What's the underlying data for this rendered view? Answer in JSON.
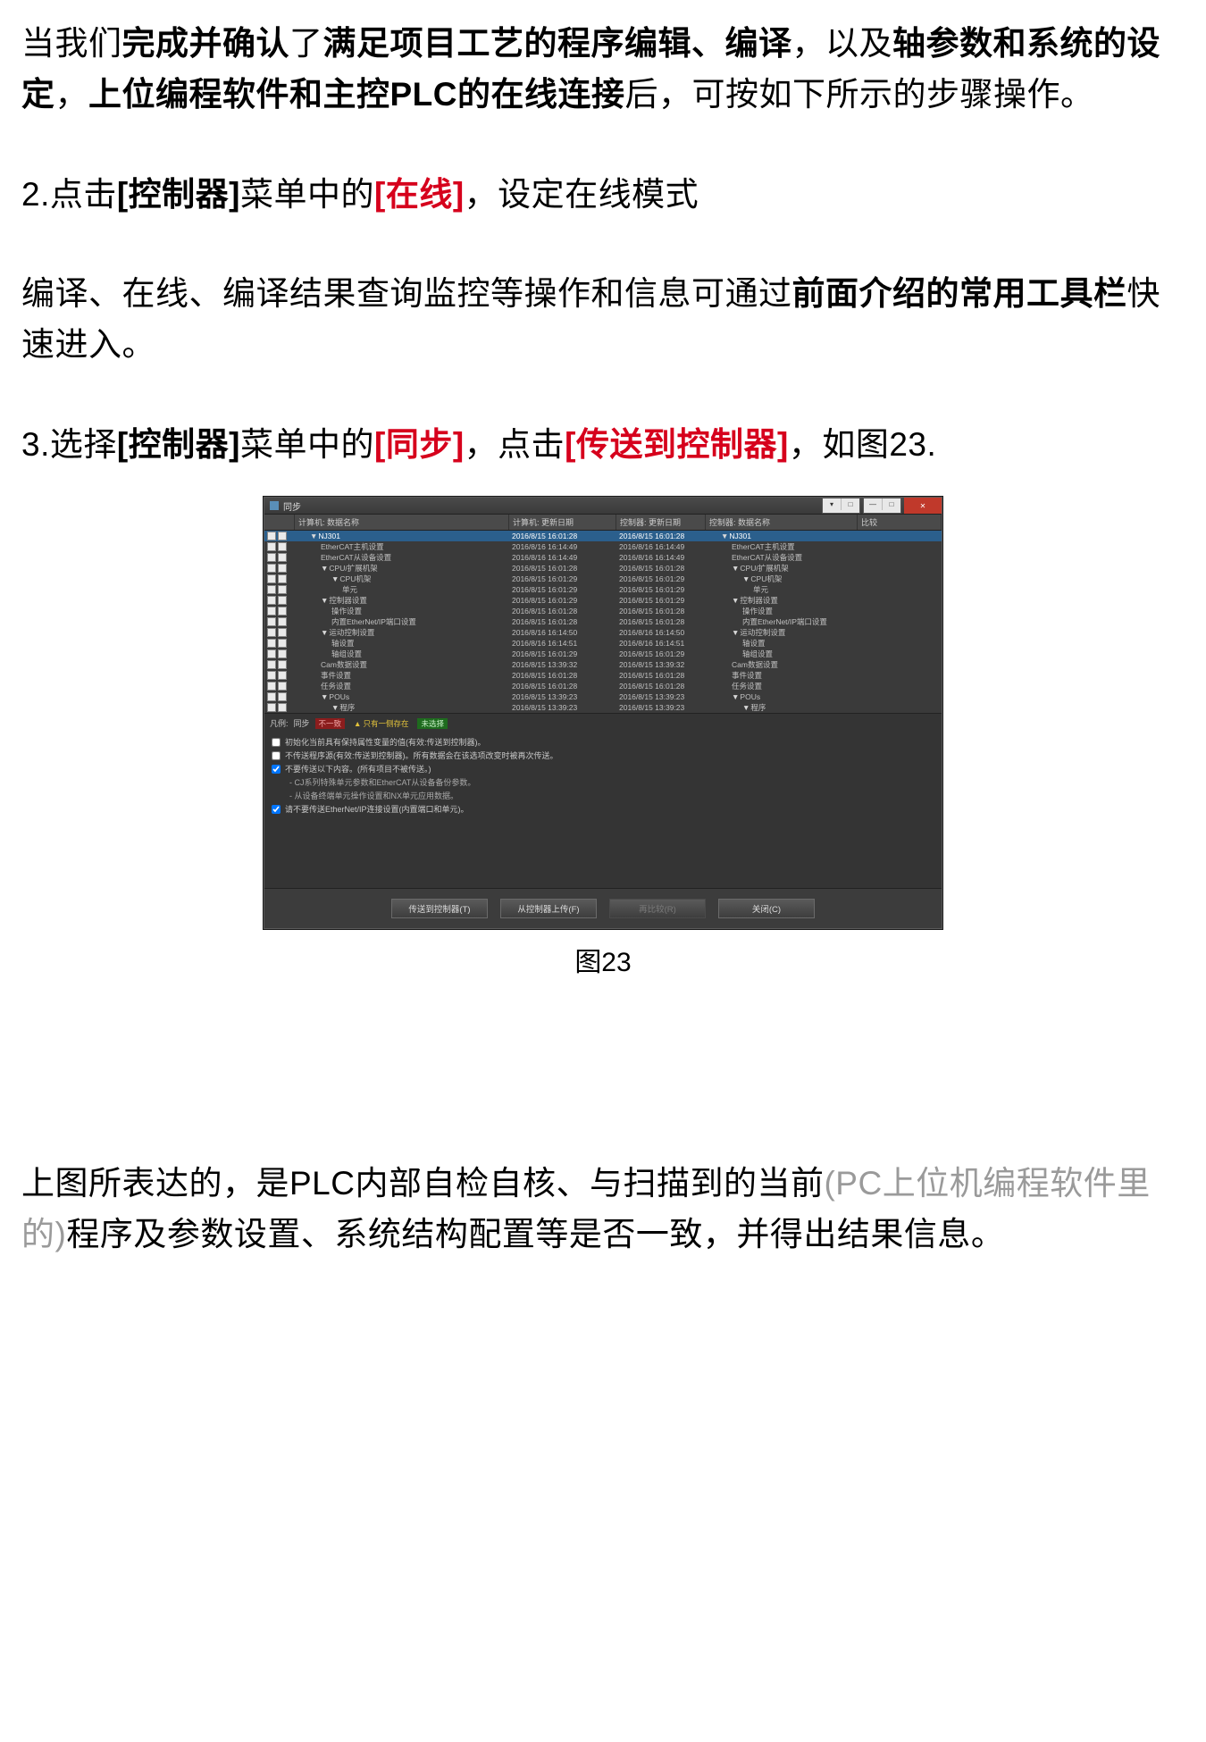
{
  "p1": {
    "a": "当我们",
    "b": "完成并确认",
    "c": "了",
    "d": "满足项目工艺的程序编辑、编译",
    "e": "，以及",
    "f": "轴参数和系统的设定",
    "g": "，",
    "h": "上位编程软件和主控PLC的在线连接",
    "i": "后，可按如下所示的步骤操作。"
  },
  "s2": {
    "a": "2.点击",
    "b": "[控制器]",
    "c": "菜单中的",
    "d": "[在线]",
    "e": "，设定在线模式"
  },
  "p3": {
    "a": "编译、在线、编译结果查询监控等操作和信息可通过",
    "b": "前面介绍的常用工具栏",
    "c": "快速进入。"
  },
  "s3": {
    "a": "3.选择",
    "b": "[控制器]",
    "c": "菜单中的",
    "d": "[同步]",
    "e": "，点击",
    "f": "[传送到控制器]",
    "g": "，如图23."
  },
  "dlg": {
    "title": "同步",
    "headers": {
      "h1": "计算机: 数据名称",
      "h2": "计算机: 更新日期",
      "h3": "控制器: 更新日期",
      "h4": "控制器: 数据名称",
      "h5": "比较"
    },
    "rows": [
      {
        "sel": true,
        "ind": 1,
        "tri": "▼",
        "n": "NJ301",
        "d1": "2016/8/15 16:01:28",
        "d2": "2016/8/15 16:01:28",
        "n2": "NJ301",
        "tri2": "▼",
        "ind2": 1
      },
      {
        "ind": 2,
        "n": "EtherCAT主机设置",
        "d1": "2016/8/16 16:14:49",
        "d2": "2016/8/16 16:14:49",
        "n2": "EtherCAT主机设置",
        "ind2": 2
      },
      {
        "ind": 2,
        "n": "EtherCAT从设备设置",
        "d1": "2016/8/16 16:14:49",
        "d2": "2016/8/16 16:14:49",
        "n2": "EtherCAT从设备设置",
        "ind2": 2
      },
      {
        "ind": 2,
        "tri": "▼",
        "n": "CPU/扩展机架",
        "d1": "2016/8/15 16:01:28",
        "d2": "2016/8/15 16:01:28",
        "n2": "CPU/扩展机架",
        "tri2": "▼",
        "ind2": 2
      },
      {
        "ind": 3,
        "tri": "▼",
        "n": "CPU机架",
        "d1": "2016/8/15 16:01:29",
        "d2": "2016/8/15 16:01:29",
        "n2": "CPU机架",
        "tri2": "▼",
        "ind2": 3
      },
      {
        "ind": 4,
        "n": "单元",
        "d1": "2016/8/15 16:01:29",
        "d2": "2016/8/15 16:01:29",
        "n2": "单元",
        "ind2": 4
      },
      {
        "ind": 2,
        "tri": "▼",
        "n": "控制器设置",
        "d1": "2016/8/15 16:01:29",
        "d2": "2016/8/15 16:01:29",
        "n2": "控制器设置",
        "tri2": "▼",
        "ind2": 2
      },
      {
        "ind": 3,
        "n": "操作设置",
        "d1": "2016/8/15 16:01:28",
        "d2": "2016/8/15 16:01:28",
        "n2": "操作设置",
        "ind2": 3
      },
      {
        "ind": 3,
        "n": "内置EtherNet/IP端口设置",
        "d1": "2016/8/15 16:01:28",
        "d2": "2016/8/15 16:01:28",
        "n2": "内置EtherNet/IP端口设置",
        "ind2": 3
      },
      {
        "ind": 2,
        "tri": "▼",
        "n": "运动控制设置",
        "d1": "2016/8/16 16:14:50",
        "d2": "2016/8/16 16:14:50",
        "n2": "运动控制设置",
        "tri2": "▼",
        "ind2": 2
      },
      {
        "ind": 3,
        "n": "轴设置",
        "d1": "2016/8/16 16:14:51",
        "d2": "2016/8/16 16:14:51",
        "n2": "轴设置",
        "ind2": 3
      },
      {
        "ind": 3,
        "n": "轴组设置",
        "d1": "2016/8/15 16:01:29",
        "d2": "2016/8/15 16:01:29",
        "n2": "轴组设置",
        "ind2": 3
      },
      {
        "ind": 2,
        "n": "Cam数据设置",
        "d1": "2016/8/15 13:39:32",
        "d2": "2016/8/15 13:39:32",
        "n2": "Cam数据设置",
        "ind2": 2
      },
      {
        "ind": 2,
        "n": "事件设置",
        "d1": "2016/8/15 16:01:28",
        "d2": "2016/8/15 16:01:28",
        "n2": "事件设置",
        "ind2": 2
      },
      {
        "ind": 2,
        "n": "任务设置",
        "d1": "2016/8/15 16:01:28",
        "d2": "2016/8/15 16:01:28",
        "n2": "任务设置",
        "ind2": 2
      },
      {
        "ind": 2,
        "tri": "▼",
        "n": "POUs",
        "d1": "2016/8/15 13:39:23",
        "d2": "2016/8/15 13:39:23",
        "n2": "POUs",
        "tri2": "▼",
        "ind2": 2
      },
      {
        "ind": 3,
        "tri": "▼",
        "n": "程序",
        "d1": "2016/8/15 13:39:23",
        "d2": "2016/8/15 13:39:23",
        "n2": "程序",
        "tri2": "▼",
        "ind2": 3
      }
    ],
    "legend": {
      "a": "凡例:",
      "b": "同步",
      "c": "不一致",
      "d": "只有一侧存在",
      "e": "未选择"
    },
    "opts": {
      "o1": "初始化当前具有保持属性变量的值(有效:传送到控制器)。",
      "o2": "不传送程序源(有效:传送到控制器)。所有数据会在该选项改变时被再次传送。",
      "o3": "不要传送以下内容。(所有项目不被传送。)",
      "o3a": "- CJ系列特殊单元参数和EtherCAT从设备备份参数。",
      "o3b": "- 从设备终端单元操作设置和NX单元应用数据。",
      "o4": "请不要传送EtherNet/IP连接设置(内置端口和单元)。"
    },
    "buttons": {
      "b1": "传送到控制器(T)",
      "b2": "从控制器上传(F)",
      "b3": "再比较(R)",
      "b4": "关闭(C)"
    }
  },
  "caption": "图23",
  "p4": {
    "a": "上图所表达的，是PLC内部自检自核、与扫描到的当前",
    "b": "(PC上位机编程软件里的)",
    "c": "程序及参数设置、系统结构配置等是否一致，并得出结果信息。"
  }
}
